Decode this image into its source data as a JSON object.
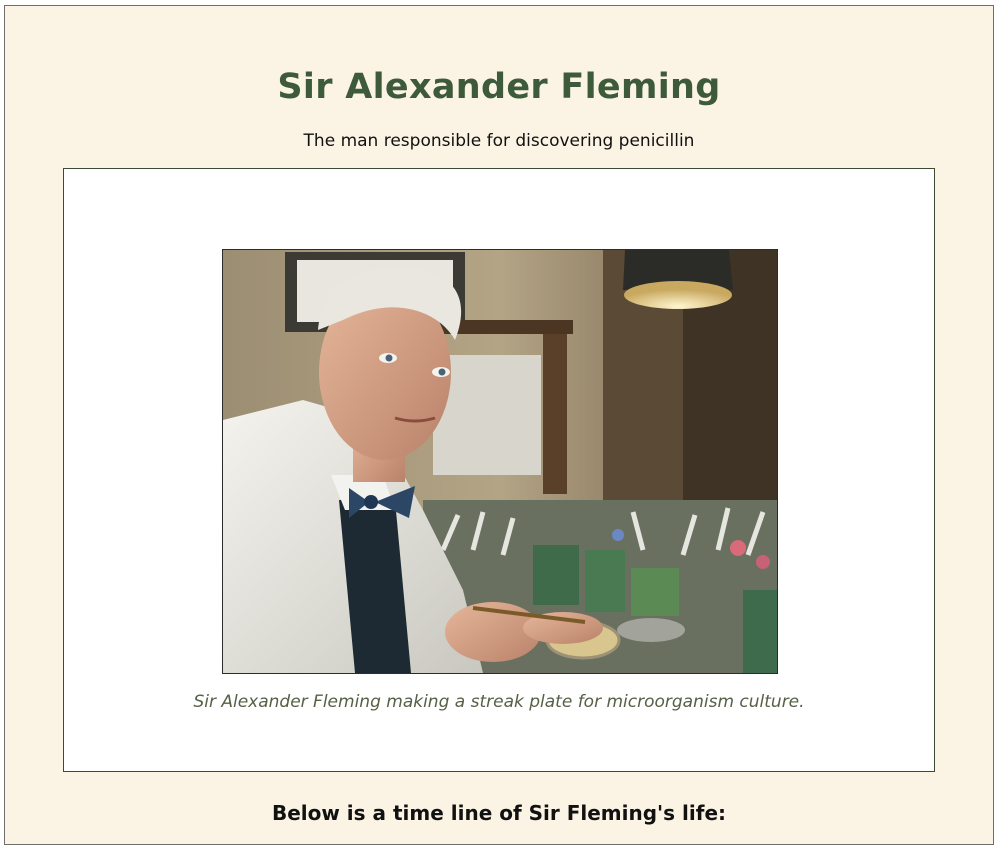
{
  "header": {
    "title": "Sir Alexander Fleming",
    "subtitle": "The man responsible for discovering penicillin"
  },
  "figure": {
    "image_alt": "Sir Alexander Fleming",
    "caption": "Sir Alexander Fleming making a streak plate for microorganism culture."
  },
  "timeline": {
    "heading": "Below is a time line of Sir Fleming's life:"
  },
  "colors": {
    "page_background": "#fbf4e5",
    "title": "#3d5a3a",
    "caption": "#566045",
    "figure_border": "#3b4a32"
  }
}
